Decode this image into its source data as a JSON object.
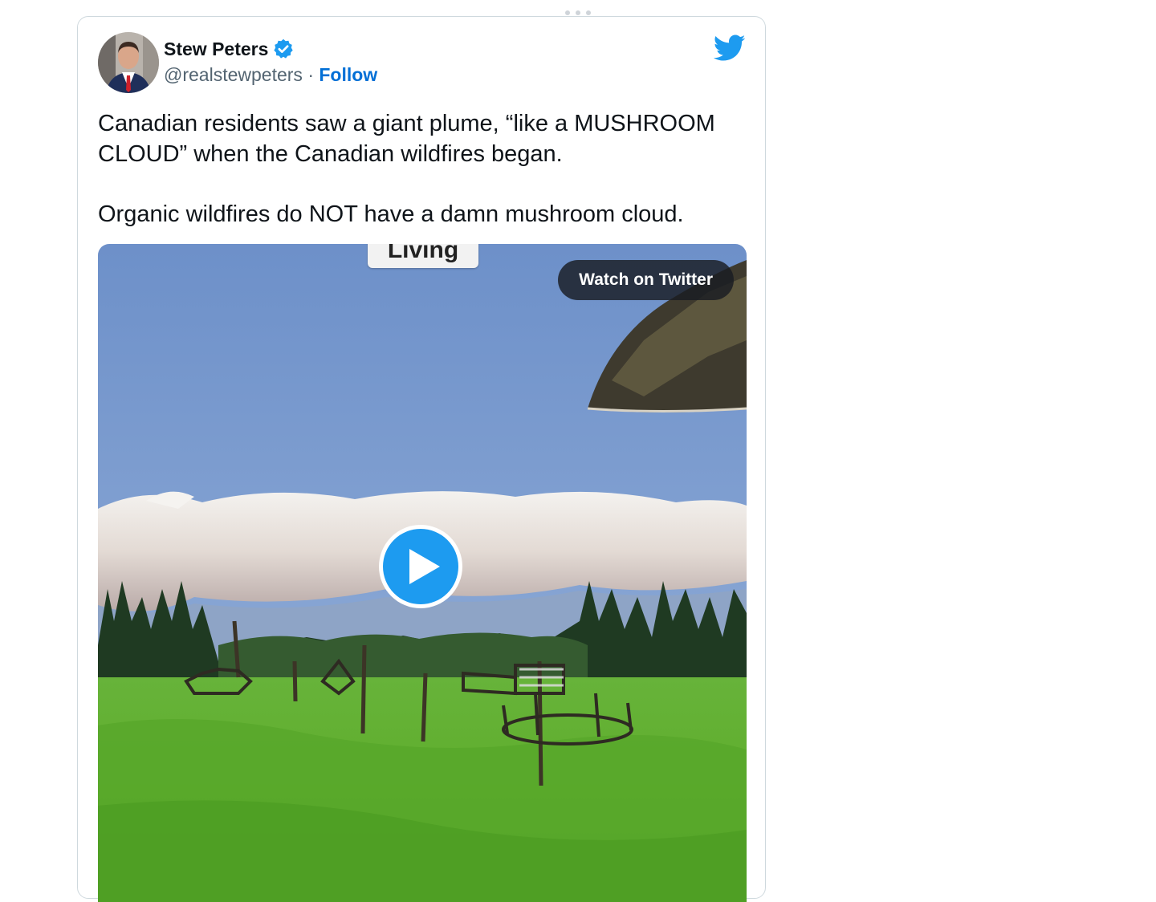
{
  "author": {
    "name": "Stew Peters",
    "handle": "@realstewpeters",
    "separator": "·",
    "follow_label": "Follow",
    "verified": true
  },
  "tweet": {
    "paragraphs": [
      "Canadian residents saw a giant plume, “like a MUSHROOM CLOUD” when the Canadian wildfires began.",
      "Organic wildfires do NOT have a damn mushroom cloud."
    ]
  },
  "media": {
    "overlay_label": "Living",
    "watch_button_label": "Watch on Twitter"
  },
  "icons": {
    "verified": "verified-badge-icon",
    "logo": "twitter-bird-icon",
    "play": "play-icon",
    "drag": "drag-handle-icon"
  },
  "colors": {
    "link": "#006fd6",
    "twitter_blue": "#1d9bf0",
    "text": "#0f1419",
    "secondary_text": "#536471",
    "border": "#cfd9de"
  }
}
